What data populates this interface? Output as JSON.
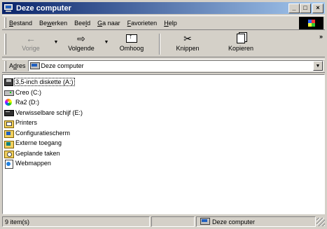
{
  "window": {
    "title": "Deze computer",
    "controls": {
      "minimize": "_",
      "maximize": "□",
      "close": "×"
    }
  },
  "menubar": {
    "items": [
      {
        "label": "Bestand",
        "mnemonic": "B",
        "rest": "estand"
      },
      {
        "label": "Bewerken",
        "pre": "Be",
        "mnemonic": "w",
        "rest": "erken"
      },
      {
        "label": "Beeld",
        "pre": "Bee",
        "mnemonic": "l",
        "rest": "d"
      },
      {
        "label": "Ga naar",
        "mnemonic": "G",
        "rest": "a naar"
      },
      {
        "label": "Favorieten",
        "mnemonic": "F",
        "rest": "avorieten"
      },
      {
        "label": "Help",
        "mnemonic": "H",
        "rest": "elp"
      }
    ]
  },
  "toolbar": {
    "back_label": "Vorige",
    "back_icon": "←",
    "forward_label": "Volgende",
    "forward_icon": "⇨",
    "up_label": "Omhoog",
    "cut_label": "Knippen",
    "cut_icon": "✂",
    "copy_label": "Kopieren",
    "more": "»"
  },
  "addressbar": {
    "label_pre": "A",
    "label_mnemonic": "d",
    "label_rest": "res",
    "value": "Deze computer"
  },
  "items": [
    {
      "name": "3,5-inch diskette (A:)",
      "icon": "floppy-icon"
    },
    {
      "name": "Creo (C:)",
      "icon": "hard-drive-icon"
    },
    {
      "name": "Ra2 (D:)",
      "icon": "cd-drive-icon"
    },
    {
      "name": "Verwisselbare schijf (E:)",
      "icon": "removable-drive-icon"
    },
    {
      "name": "Printers",
      "icon": "printers-folder-icon"
    },
    {
      "name": "Configuratiescherm",
      "icon": "control-panel-icon"
    },
    {
      "name": "Externe toegang",
      "icon": "dial-up-networking-icon"
    },
    {
      "name": "Geplande taken",
      "icon": "scheduled-tasks-icon"
    },
    {
      "name": "Webmappen",
      "icon": "web-folders-icon"
    }
  ],
  "statusbar": {
    "count": "9 item(s)",
    "zone": "Deze computer"
  }
}
